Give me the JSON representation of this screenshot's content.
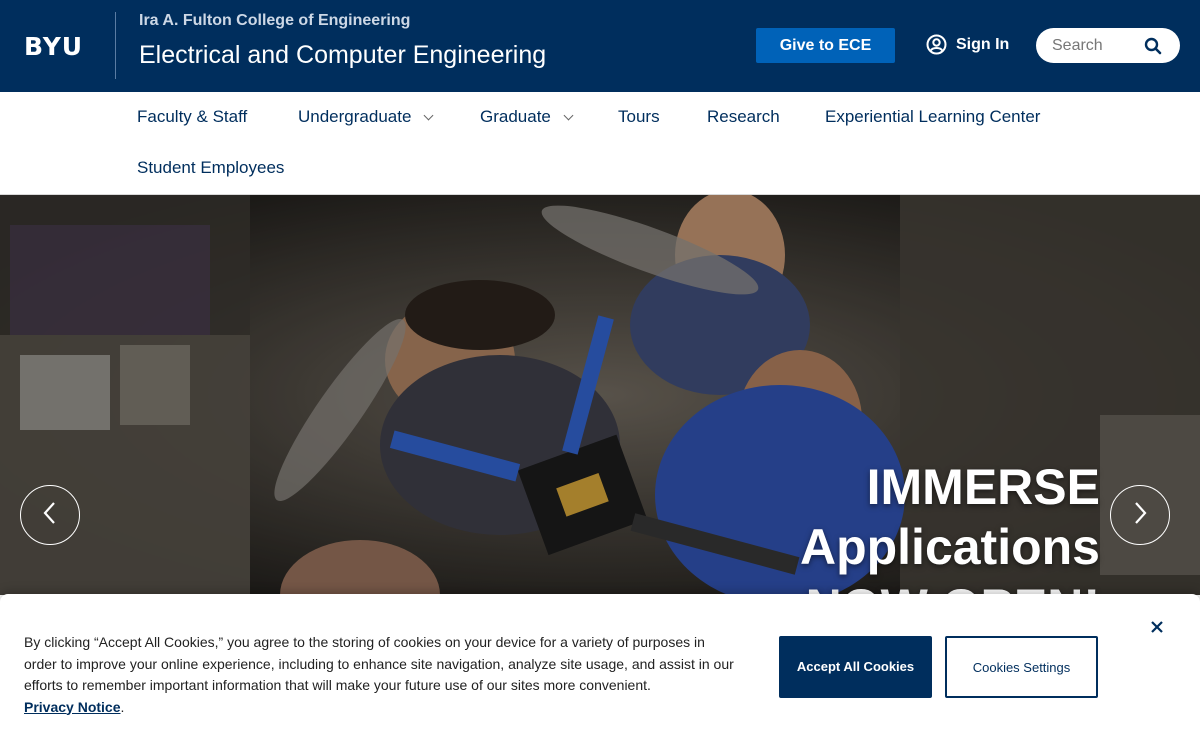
{
  "header": {
    "logo": "BYU",
    "college": "Ira A. Fulton College of Engineering",
    "department": "Electrical and Computer Engineering",
    "give_label": "Give to ECE",
    "signin_label": "Sign In",
    "search_placeholder": "Search"
  },
  "nav": {
    "items": [
      {
        "label": "Faculty & Staff"
      },
      {
        "label": "Undergraduate"
      },
      {
        "label": "Graduate"
      },
      {
        "label": "Tours"
      },
      {
        "label": "Research"
      },
      {
        "label": "Experiential Learning Center"
      },
      {
        "label": "Student Employees"
      }
    ]
  },
  "hero": {
    "line1": "IMMERSE",
    "line2": "Applications",
    "line3": "NOW OPEN!"
  },
  "cookie": {
    "text": "By clicking “Accept All Cookies,” you agree to the storing of cookies on your device for a variety of purposes in order to improve your online experience, including to enhance site navigation, analyze site usage, and assist in our efforts to remember important information that will make your future use of our sites more convenient.",
    "privacy_label": "Privacy Notice",
    "accept_label": "Accept All Cookies",
    "settings_label": "Cookies Settings"
  },
  "colors": {
    "brand_navy": "#002e5d",
    "give_blue": "#0062b8"
  }
}
